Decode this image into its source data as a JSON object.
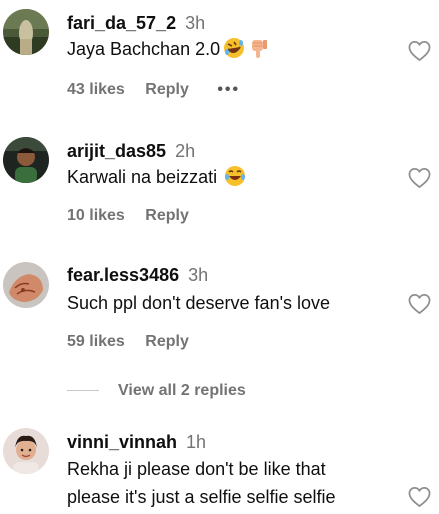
{
  "comments": [
    {
      "username": "fari_da_57_2",
      "time": "3h",
      "text": "Jaya Bachchan 2.0",
      "emojis": [
        "rolling-laughing-emoji",
        "thumbs-down-emoji"
      ],
      "likes": "43 likes",
      "reply": "Reply",
      "more": "•••"
    },
    {
      "username": "arijit_das85",
      "time": "2h",
      "text": "Karwali na beizzati",
      "emojis": [
        "tears-of-joy-emoji"
      ],
      "likes": "10 likes",
      "reply": "Reply"
    },
    {
      "username": "fear.less3486",
      "time": "3h",
      "text": "Such ppl don't deserve fan's love",
      "likes": "59 likes",
      "reply": "Reply"
    },
    {
      "username": "vinni_vinnah",
      "time": "1h",
      "text_line1": "Rekha ji please don't be like that",
      "text_line2": "please it's just a selfie selfie selfie"
    }
  ],
  "view_replies": "View all 2 replies",
  "colors": {
    "text": "#0f0f0f",
    "secondary": "#737373",
    "divider": "#c7c7c7"
  }
}
